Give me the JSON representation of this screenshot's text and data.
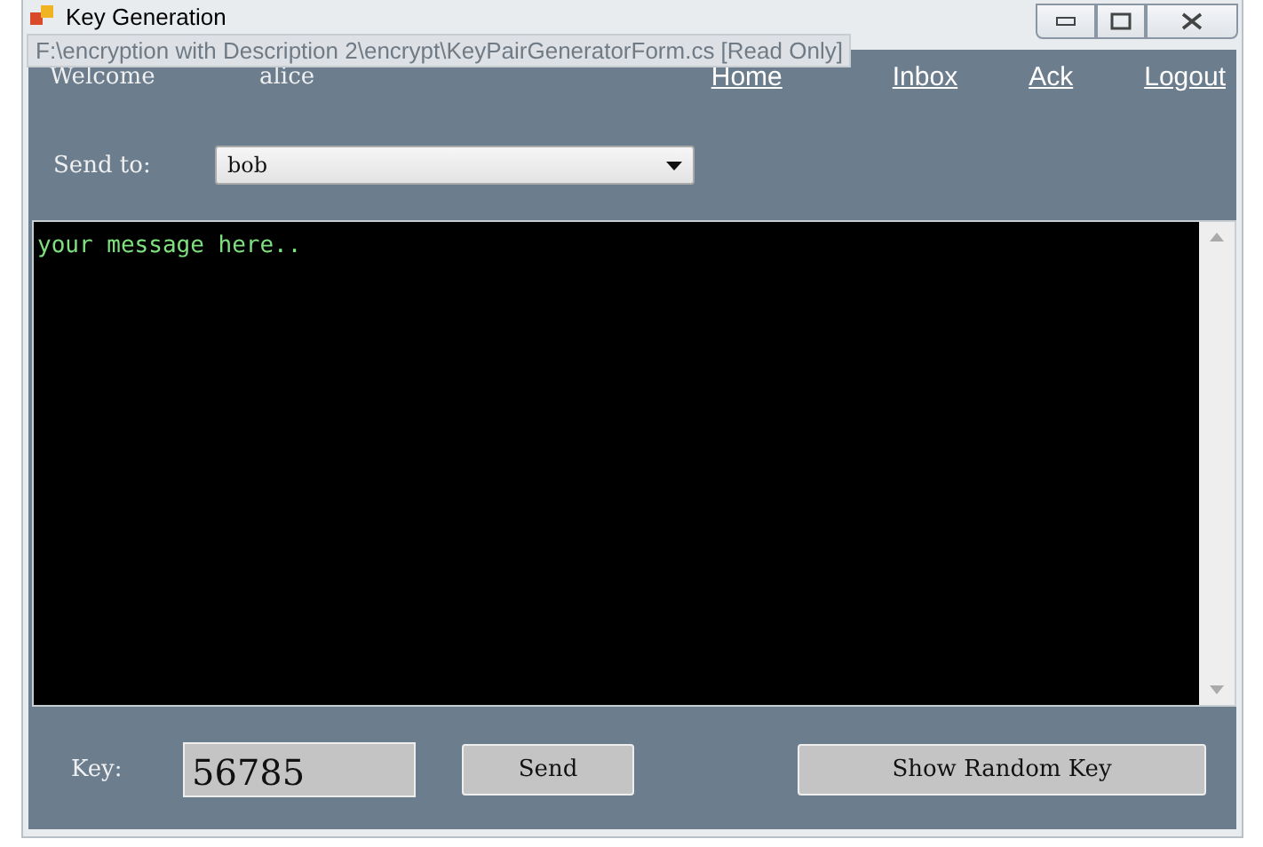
{
  "window": {
    "title": "Key Generation"
  },
  "tooltip": "F:\\encryption with Description 2\\encrypt\\KeyPairGeneratorForm.cs [Read Only]",
  "header": {
    "welcome_label": "Welcome",
    "user": "alice"
  },
  "nav_links": [
    "Home",
    "Inbox",
    "Ack",
    "Logout"
  ],
  "send_to": {
    "label": "Send to:",
    "value": "bob"
  },
  "message": {
    "value": "your message here.."
  },
  "key": {
    "label": "Key:",
    "value": "56785"
  },
  "buttons": [
    "Send",
    "Show Random Key"
  ]
}
